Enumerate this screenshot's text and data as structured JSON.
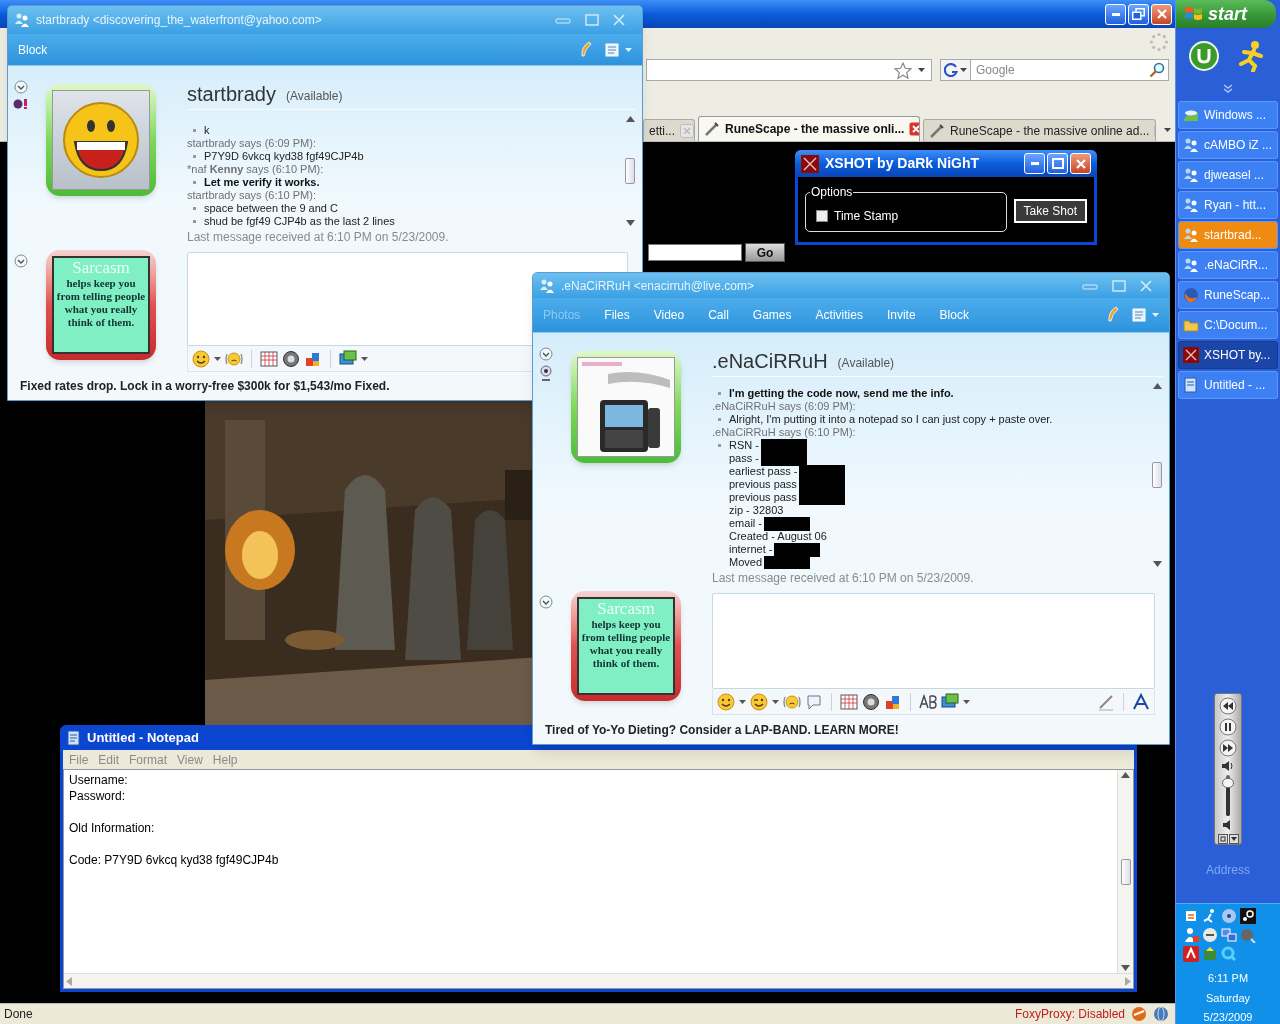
{
  "browser": {
    "tabs": [
      {
        "label": "etti...",
        "selected": false,
        "icon": false
      },
      {
        "label": "RuneScape - the massive onli...",
        "selected": true,
        "icon": true
      },
      {
        "label": "RuneScape - the massive online ad...",
        "selected": false,
        "icon": true
      }
    ],
    "search": {
      "placeholder": "Google"
    },
    "page": {
      "go_button": "Go"
    },
    "status_bar": {
      "text": "Done",
      "proxy": "FoxyProxy: Disabled"
    }
  },
  "yahoo_chat": {
    "title": "startbrady <discovering_the_waterfront@yahoo.com>",
    "toolbar": [
      {
        "label": "Block",
        "disabled": false
      }
    ],
    "contact": {
      "name": "startbrady",
      "status": "(Available)"
    },
    "messages": [
      {
        "kind": "line",
        "text": "k",
        "bold": false
      },
      {
        "kind": "header",
        "text": "startbrady says (6:09 PM):"
      },
      {
        "kind": "line",
        "text": "P7Y9D 6vkcq kyd38 fgf49CJP4b",
        "bold": false
      },
      {
        "kind": "header",
        "text": "*naf **Kenny** says (6:10 PM):"
      },
      {
        "kind": "line",
        "text": "Let me verify it works.",
        "bold": true
      },
      {
        "kind": "header",
        "text": "startbrady says (6:10 PM):"
      },
      {
        "kind": "line",
        "text": "space between the 9 and C",
        "bold": false
      },
      {
        "kind": "line",
        "text": "shud be fgf49 CJP4b as the last 2 lines",
        "bold": false
      }
    ],
    "last_message": "Last message received at 6:10 PM on 5/23/2009.",
    "display_picture": {
      "heading": "Sarcasm",
      "text": "helps keep you from telling people what you really think of them."
    },
    "ad": "Fixed rates drop. Lock in a worry-free $300k for $1,543/mo Fixed."
  },
  "xshot": {
    "title": "XSHOT by DaRk NiGhT",
    "group": "Options",
    "checkbox": {
      "label": "Time Stamp",
      "checked": false
    },
    "button": "Take Shot"
  },
  "live_chat": {
    "title": ".eNaCiRRuH <enacirruh@live.com>",
    "toolbar": [
      {
        "label": "Photos",
        "disabled": true
      },
      {
        "label": "Files",
        "disabled": false
      },
      {
        "label": "Video",
        "disabled": false
      },
      {
        "label": "Call",
        "disabled": false
      },
      {
        "label": "Games",
        "disabled": false
      },
      {
        "label": "Activities",
        "disabled": false
      },
      {
        "label": "Invite",
        "disabled": false
      },
      {
        "label": "Block",
        "disabled": false
      }
    ],
    "contact": {
      "name": ".eNaCiRRuH",
      "status": "(Available)"
    },
    "messages": [
      {
        "kind": "line",
        "text": "I'm getting the code now, send me the info.",
        "bold": true
      },
      {
        "kind": "header",
        "text": ".eNaCiRRuH says (6:09 PM):"
      },
      {
        "kind": "line",
        "text": "Alright, I'm putting it into a notepad so I can just copy + paste over.",
        "bold": false
      },
      {
        "kind": "header",
        "text": ".eNaCiRRuH says (6:10 PM):"
      },
      {
        "kind": "list",
        "items": [
          {
            "text": "RSN -",
            "redacted": true
          },
          {
            "text": "pass -",
            "redacted": true
          },
          {
            "text": "earliest pass -",
            "redacted": true
          },
          {
            "text": "previous pass",
            "redacted": true
          },
          {
            "text": "previous pass",
            "redacted": true
          },
          {
            "text": "zip - 32803",
            "redacted": false
          },
          {
            "text": "email -",
            "redacted": true
          },
          {
            "text": "Created - August 06",
            "redacted": false
          },
          {
            "text": "internet -",
            "redacted": true
          },
          {
            "text": "Moved",
            "redacted": true
          }
        ]
      }
    ],
    "last_message": "Last message received at 6:10 PM on 5/23/2009.",
    "display_picture": {
      "heading": "Sarcasm",
      "text": "helps keep you from telling people what you really think of them."
    },
    "ad": "Tired of Yo-Yo Dieting? Consider a LAP-BAND. LEARN MORE!"
  },
  "notepad": {
    "title": "Untitled - Notepad",
    "menu": [
      "File",
      "Edit",
      "Format",
      "View",
      "Help"
    ],
    "text": "Username:\nPassword:\n\nOld Information:\n\nCode: P7Y9D 6vkcq kyd38 fgf49CJP4b"
  },
  "taskbar": {
    "start": "start",
    "buttons": [
      {
        "label": "Windows ...",
        "kind": "media",
        "selected": false,
        "flashing": false
      },
      {
        "label": "cAMBO iZ ...",
        "kind": "messenger",
        "selected": false,
        "flashing": false
      },
      {
        "label": "djweasel ...",
        "kind": "messenger",
        "selected": false,
        "flashing": false
      },
      {
        "label": "Ryan - htt...",
        "kind": "messenger",
        "selected": false,
        "flashing": false
      },
      {
        "label": "startbrad...",
        "kind": "messenger",
        "selected": false,
        "flashing": true
      },
      {
        "label": ".eNaCiRR...",
        "kind": "messenger",
        "selected": false,
        "flashing": false
      },
      {
        "label": "RuneScap...",
        "kind": "browser",
        "selected": false,
        "flashing": false
      },
      {
        "label": "C:\\Docum...",
        "kind": "folder",
        "selected": false,
        "flashing": false
      },
      {
        "label": "XSHOT by...",
        "kind": "xshot",
        "selected": true,
        "flashing": false
      },
      {
        "label": "Untitled - ...",
        "kind": "notepad",
        "selected": false,
        "flashing": false
      }
    ],
    "volume": {
      "level": 0.85
    },
    "address": "Address",
    "clock": [
      "6:11 PM",
      "Saturday",
      "5/23/2009"
    ]
  }
}
